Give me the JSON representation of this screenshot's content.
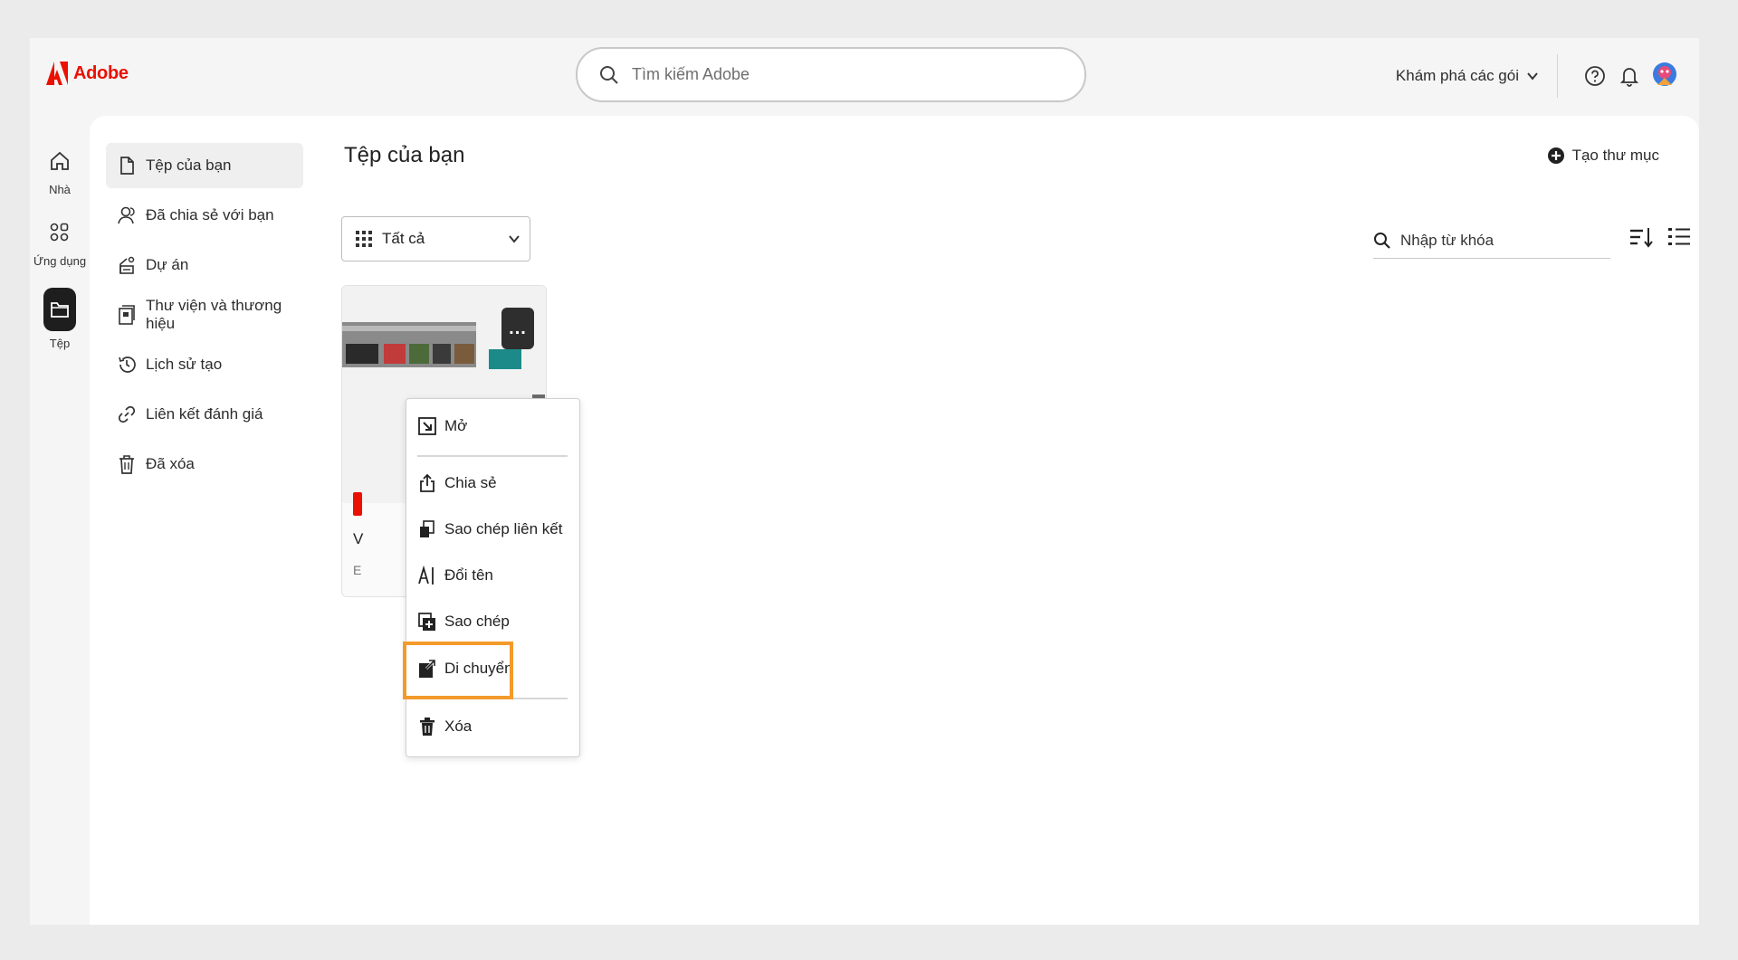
{
  "header": {
    "brand": "Adobe",
    "search_placeholder": "Tìm kiếm Adobe",
    "explore_plans": "Khám phá các gói"
  },
  "rail": {
    "items": [
      {
        "label": "Nhà",
        "icon": "home-icon"
      },
      {
        "label": "Ứng dụng",
        "icon": "apps-icon"
      },
      {
        "label": "Tệp",
        "icon": "folder-icon",
        "active": true
      }
    ]
  },
  "sidenav": {
    "items": [
      {
        "label": "Tệp của bạn",
        "icon": "file-icon",
        "active": true
      },
      {
        "label": "Đã chia sẻ với bạn",
        "icon": "shared-users-icon"
      },
      {
        "label": "Dự án",
        "icon": "project-icon"
      },
      {
        "label": "Thư viện và thương hiệu",
        "icon": "library-icon"
      },
      {
        "label": "Lịch sử tạo",
        "icon": "history-icon"
      },
      {
        "label": "Liên kết đánh giá",
        "icon": "link-icon"
      },
      {
        "label": "Đã xóa",
        "icon": "trash-icon"
      }
    ]
  },
  "main": {
    "title": "Tệp của bạn",
    "create_folder": "Tạo thư mục",
    "filter_value": "Tất cả",
    "keyword_placeholder": "Nhập từ khóa"
  },
  "card": {
    "more_label": "...",
    "name_visible": "V",
    "meta_visible": "E"
  },
  "context_menu": {
    "items": [
      {
        "label": "Mở",
        "icon": "open-icon"
      },
      {
        "label": "Chia sẻ",
        "icon": "share-icon"
      },
      {
        "label": "Sao chép liên kết",
        "icon": "copy-link-icon"
      },
      {
        "label": "Đổi tên",
        "icon": "rename-icon"
      },
      {
        "label": "Sao chép",
        "icon": "duplicate-icon"
      },
      {
        "label": "Di chuyển",
        "icon": "move-icon",
        "highlighted": true
      },
      {
        "label": "Xóa",
        "icon": "delete-icon"
      }
    ]
  },
  "colors": {
    "brand_red": "#eb1000",
    "highlight_orange": "#f39a2b",
    "active_rail": "#1e1e1e"
  }
}
